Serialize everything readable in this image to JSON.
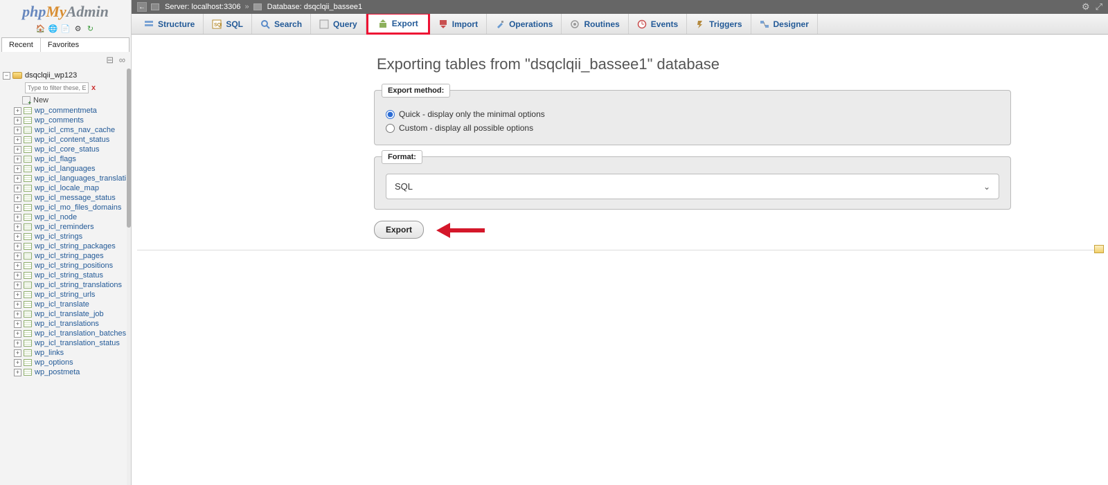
{
  "logo": {
    "p1": "php",
    "p2": "My",
    "p3": "Admin"
  },
  "sidebar": {
    "tabs": [
      "Recent",
      "Favorites"
    ],
    "db_name": "dsqclqii_wp123",
    "filter_placeholder": "Type to filter these, Enter",
    "new_label": "New",
    "tables": [
      "wp_commentmeta",
      "wp_comments",
      "wp_icl_cms_nav_cache",
      "wp_icl_content_status",
      "wp_icl_core_status",
      "wp_icl_flags",
      "wp_icl_languages",
      "wp_icl_languages_translati",
      "wp_icl_locale_map",
      "wp_icl_message_status",
      "wp_icl_mo_files_domains",
      "wp_icl_node",
      "wp_icl_reminders",
      "wp_icl_strings",
      "wp_icl_string_packages",
      "wp_icl_string_pages",
      "wp_icl_string_positions",
      "wp_icl_string_status",
      "wp_icl_string_translations",
      "wp_icl_string_urls",
      "wp_icl_translate",
      "wp_icl_translate_job",
      "wp_icl_translations",
      "wp_icl_translation_batches",
      "wp_icl_translation_status",
      "wp_links",
      "wp_options",
      "wp_postmeta"
    ]
  },
  "breadcrumb": {
    "server_label": "Server: localhost:3306",
    "db_label": "Database: dsqclqii_bassee1"
  },
  "tabs": [
    {
      "label": "Structure",
      "icon": "structure"
    },
    {
      "label": "SQL",
      "icon": "sql"
    },
    {
      "label": "Search",
      "icon": "search"
    },
    {
      "label": "Query",
      "icon": "query"
    },
    {
      "label": "Export",
      "icon": "export",
      "active": true
    },
    {
      "label": "Import",
      "icon": "import"
    },
    {
      "label": "Operations",
      "icon": "operations"
    },
    {
      "label": "Routines",
      "icon": "routines"
    },
    {
      "label": "Events",
      "icon": "events"
    },
    {
      "label": "Triggers",
      "icon": "triggers"
    },
    {
      "label": "Designer",
      "icon": "designer"
    }
  ],
  "page": {
    "title": "Exporting tables from \"dsqclqii_bassee1\" database",
    "method_legend": "Export method:",
    "method_quick": "Quick - display only the minimal options",
    "method_custom": "Custom - display all possible options",
    "format_legend": "Format:",
    "format_value": "SQL",
    "go_label": "Export"
  }
}
